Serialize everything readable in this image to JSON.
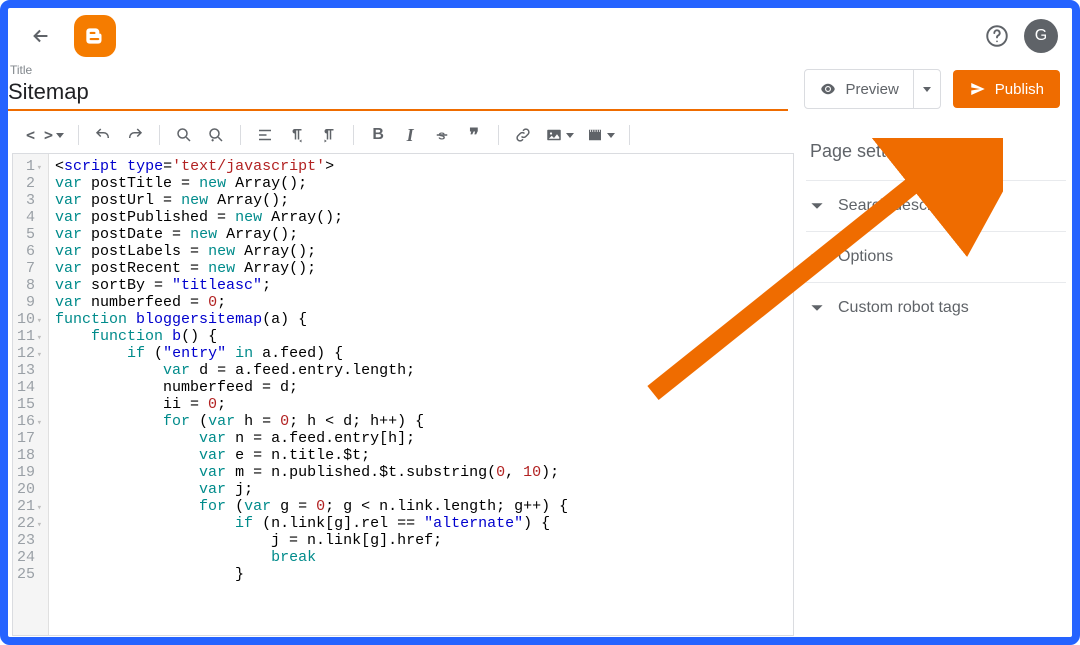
{
  "header": {
    "avatar_initial": "G"
  },
  "title": {
    "label": "Title",
    "value": "Sitemap"
  },
  "actions": {
    "preview_label": "Preview",
    "publish_label": "Publish"
  },
  "side": {
    "heading": "Page settings",
    "items": [
      {
        "label": "Search description"
      },
      {
        "label": "Options"
      },
      {
        "label": "Custom robot tags"
      }
    ]
  },
  "editor": {
    "lines": [
      {
        "n": "1",
        "fold": true
      },
      {
        "n": "2"
      },
      {
        "n": "3"
      },
      {
        "n": "4"
      },
      {
        "n": "5"
      },
      {
        "n": "6"
      },
      {
        "n": "7"
      },
      {
        "n": "8"
      },
      {
        "n": "9"
      },
      {
        "n": "10",
        "fold": true
      },
      {
        "n": "11",
        "fold": true
      },
      {
        "n": "12",
        "fold": true
      },
      {
        "n": "13"
      },
      {
        "n": "14"
      },
      {
        "n": "15"
      },
      {
        "n": "16",
        "fold": true
      },
      {
        "n": "17"
      },
      {
        "n": "18"
      },
      {
        "n": "19"
      },
      {
        "n": "20"
      },
      {
        "n": "21",
        "fold": true
      },
      {
        "n": "22",
        "fold": true
      },
      {
        "n": "23"
      },
      {
        "n": "24"
      },
      {
        "n": "25"
      }
    ]
  }
}
